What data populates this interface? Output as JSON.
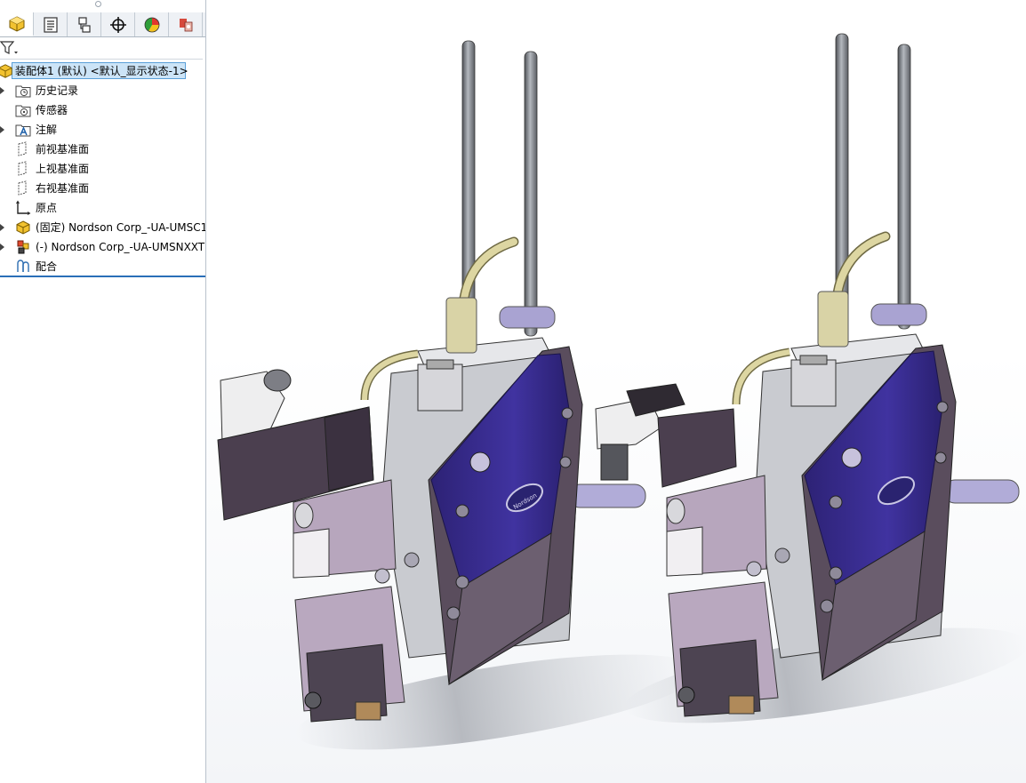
{
  "feature_manager": {
    "tabs": [
      {
        "name": "feature-tree",
        "icon": "assembly-cube-icon"
      },
      {
        "name": "property",
        "icon": "property-list-icon"
      },
      {
        "name": "configuration",
        "icon": "configuration-icon"
      },
      {
        "name": "dimxpert",
        "icon": "crosshair-icon"
      },
      {
        "name": "display",
        "icon": "display-pie-icon"
      },
      {
        "name": "appearance",
        "icon": "appearance-icon"
      }
    ],
    "filter_icon": "funnel-filter-icon",
    "root_label": "装配体1 (默认) <默认_显示状态-1>",
    "items": [
      {
        "label": "历史记录",
        "icon": "history-folder-icon",
        "expandable": true
      },
      {
        "label": "传感器",
        "icon": "sensor-folder-icon",
        "expandable": false
      },
      {
        "label": "注解",
        "icon": "annotation-folder-icon",
        "expandable": true
      },
      {
        "label": "前视基准面",
        "icon": "plane-icon",
        "expandable": false
      },
      {
        "label": "上视基准面",
        "icon": "plane-icon",
        "expandable": false
      },
      {
        "label": "右视基准面",
        "icon": "plane-icon",
        "expandable": false
      },
      {
        "label": "原点",
        "icon": "origin-icon",
        "expandable": false
      },
      {
        "label": "(固定) Nordson Corp_-UA-UMSC1",
        "icon": "part-icon",
        "expandable": true
      },
      {
        "label": "(-) Nordson Corp_-UA-UMSNXXT",
        "icon": "part-icon",
        "expandable": true
      },
      {
        "label": "配合",
        "icon": "mates-icon",
        "expandable": false
      }
    ]
  },
  "viewport": {
    "model_brand_text": "Nordson",
    "colors": {
      "body_purple": "#3c2f8c",
      "dark_body": "#4e4150",
      "silver": "#c7c8cc",
      "gold_tube": "#d8cf9a"
    }
  }
}
